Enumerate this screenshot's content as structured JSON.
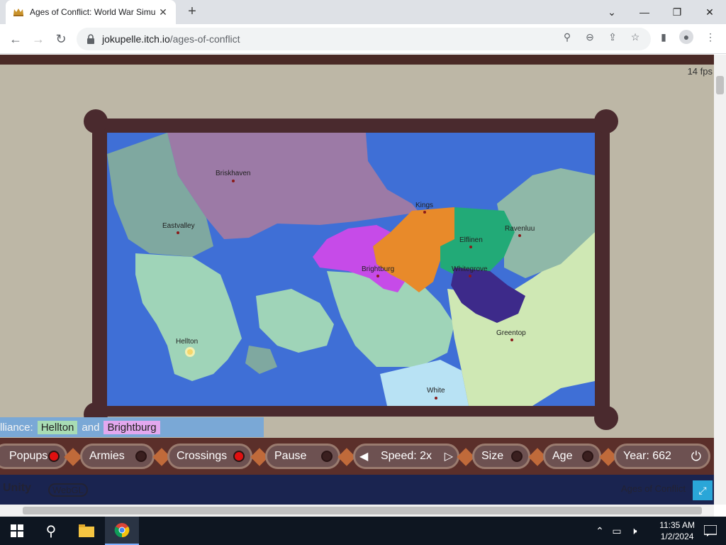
{
  "browser": {
    "tab_title": "Ages of Conflict: World War Simu",
    "tab_close": "✕",
    "new_tab": "+",
    "minimize": "—",
    "maximize": "❐",
    "close": "✕",
    "url_domain": "jokupelle.itch.io",
    "url_path": "/ages-of-conflict"
  },
  "game": {
    "fps": "14 fps",
    "cities": [
      "Briskhaven",
      "Eastvalley",
      "Kings",
      "Elflinen",
      "Ravenluu",
      "Brightburg",
      "Whitegrove",
      "Hellton",
      "Greentop",
      "White"
    ],
    "alliance": {
      "prefix": "lliance:",
      "party1": "Hellton",
      "joiner": "and",
      "party2": "Brightburg"
    },
    "controls": {
      "popups": "Popups",
      "armies": "Armies",
      "crossings": "Crossings",
      "pause": "Pause",
      "speed": "Speed: 2x",
      "size": "Size",
      "age": "Age",
      "year": "Year: 662"
    },
    "footer": {
      "unity": "Unity",
      "webgl": "WebGL",
      "title": "Ages of Conflict"
    },
    "colors": {
      "ocean": "#3f6fd6",
      "frame": "#4a2a2e",
      "purple_region": "#9c7aa6",
      "teal_region": "#7fa8a0",
      "mint_region": "#9fd4b8",
      "orange_region": "#e88a2a",
      "magenta_region": "#c64be8",
      "green_region": "#22aa77",
      "indigo_region": "#3d2a8a",
      "lime_region": "#cfe8b4",
      "lightblue_region": "#b8e2f4",
      "sage_region": "#8fb8a8"
    }
  },
  "taskbar": {
    "time": "11:35 AM",
    "date": "1/2/2024"
  }
}
